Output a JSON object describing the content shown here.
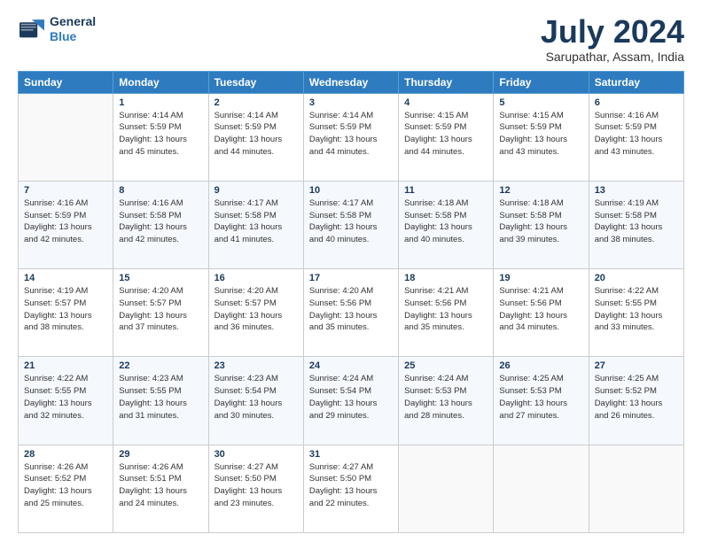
{
  "logo": {
    "line1": "General",
    "line2": "Blue"
  },
  "title": "July 2024",
  "location": "Sarupathar, Assam, India",
  "days_header": [
    "Sunday",
    "Monday",
    "Tuesday",
    "Wednesday",
    "Thursday",
    "Friday",
    "Saturday"
  ],
  "weeks": [
    [
      {
        "day": "",
        "info": ""
      },
      {
        "day": "1",
        "info": "Sunrise: 4:14 AM\nSunset: 5:59 PM\nDaylight: 13 hours\nand 45 minutes."
      },
      {
        "day": "2",
        "info": "Sunrise: 4:14 AM\nSunset: 5:59 PM\nDaylight: 13 hours\nand 44 minutes."
      },
      {
        "day": "3",
        "info": "Sunrise: 4:14 AM\nSunset: 5:59 PM\nDaylight: 13 hours\nand 44 minutes."
      },
      {
        "day": "4",
        "info": "Sunrise: 4:15 AM\nSunset: 5:59 PM\nDaylight: 13 hours\nand 44 minutes."
      },
      {
        "day": "5",
        "info": "Sunrise: 4:15 AM\nSunset: 5:59 PM\nDaylight: 13 hours\nand 43 minutes."
      },
      {
        "day": "6",
        "info": "Sunrise: 4:16 AM\nSunset: 5:59 PM\nDaylight: 13 hours\nand 43 minutes."
      }
    ],
    [
      {
        "day": "7",
        "info": "Sunrise: 4:16 AM\nSunset: 5:59 PM\nDaylight: 13 hours\nand 42 minutes."
      },
      {
        "day": "8",
        "info": "Sunrise: 4:16 AM\nSunset: 5:58 PM\nDaylight: 13 hours\nand 42 minutes."
      },
      {
        "day": "9",
        "info": "Sunrise: 4:17 AM\nSunset: 5:58 PM\nDaylight: 13 hours\nand 41 minutes."
      },
      {
        "day": "10",
        "info": "Sunrise: 4:17 AM\nSunset: 5:58 PM\nDaylight: 13 hours\nand 40 minutes."
      },
      {
        "day": "11",
        "info": "Sunrise: 4:18 AM\nSunset: 5:58 PM\nDaylight: 13 hours\nand 40 minutes."
      },
      {
        "day": "12",
        "info": "Sunrise: 4:18 AM\nSunset: 5:58 PM\nDaylight: 13 hours\nand 39 minutes."
      },
      {
        "day": "13",
        "info": "Sunrise: 4:19 AM\nSunset: 5:58 PM\nDaylight: 13 hours\nand 38 minutes."
      }
    ],
    [
      {
        "day": "14",
        "info": "Sunrise: 4:19 AM\nSunset: 5:57 PM\nDaylight: 13 hours\nand 38 minutes."
      },
      {
        "day": "15",
        "info": "Sunrise: 4:20 AM\nSunset: 5:57 PM\nDaylight: 13 hours\nand 37 minutes."
      },
      {
        "day": "16",
        "info": "Sunrise: 4:20 AM\nSunset: 5:57 PM\nDaylight: 13 hours\nand 36 minutes."
      },
      {
        "day": "17",
        "info": "Sunrise: 4:20 AM\nSunset: 5:56 PM\nDaylight: 13 hours\nand 35 minutes."
      },
      {
        "day": "18",
        "info": "Sunrise: 4:21 AM\nSunset: 5:56 PM\nDaylight: 13 hours\nand 35 minutes."
      },
      {
        "day": "19",
        "info": "Sunrise: 4:21 AM\nSunset: 5:56 PM\nDaylight: 13 hours\nand 34 minutes."
      },
      {
        "day": "20",
        "info": "Sunrise: 4:22 AM\nSunset: 5:55 PM\nDaylight: 13 hours\nand 33 minutes."
      }
    ],
    [
      {
        "day": "21",
        "info": "Sunrise: 4:22 AM\nSunset: 5:55 PM\nDaylight: 13 hours\nand 32 minutes."
      },
      {
        "day": "22",
        "info": "Sunrise: 4:23 AM\nSunset: 5:55 PM\nDaylight: 13 hours\nand 31 minutes."
      },
      {
        "day": "23",
        "info": "Sunrise: 4:23 AM\nSunset: 5:54 PM\nDaylight: 13 hours\nand 30 minutes."
      },
      {
        "day": "24",
        "info": "Sunrise: 4:24 AM\nSunset: 5:54 PM\nDaylight: 13 hours\nand 29 minutes."
      },
      {
        "day": "25",
        "info": "Sunrise: 4:24 AM\nSunset: 5:53 PM\nDaylight: 13 hours\nand 28 minutes."
      },
      {
        "day": "26",
        "info": "Sunrise: 4:25 AM\nSunset: 5:53 PM\nDaylight: 13 hours\nand 27 minutes."
      },
      {
        "day": "27",
        "info": "Sunrise: 4:25 AM\nSunset: 5:52 PM\nDaylight: 13 hours\nand 26 minutes."
      }
    ],
    [
      {
        "day": "28",
        "info": "Sunrise: 4:26 AM\nSunset: 5:52 PM\nDaylight: 13 hours\nand 25 minutes."
      },
      {
        "day": "29",
        "info": "Sunrise: 4:26 AM\nSunset: 5:51 PM\nDaylight: 13 hours\nand 24 minutes."
      },
      {
        "day": "30",
        "info": "Sunrise: 4:27 AM\nSunset: 5:50 PM\nDaylight: 13 hours\nand 23 minutes."
      },
      {
        "day": "31",
        "info": "Sunrise: 4:27 AM\nSunset: 5:50 PM\nDaylight: 13 hours\nand 22 minutes."
      },
      {
        "day": "",
        "info": ""
      },
      {
        "day": "",
        "info": ""
      },
      {
        "day": "",
        "info": ""
      }
    ]
  ]
}
